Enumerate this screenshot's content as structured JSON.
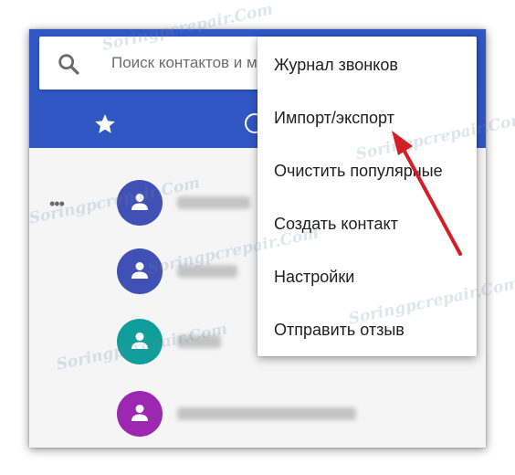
{
  "search": {
    "placeholder": "Поиск контактов и м"
  },
  "icons": {
    "search": "search-icon",
    "tab_favorites": "star-icon",
    "tab_frequent": "clock-icon",
    "overflow": "more-dots-icon",
    "avatar": "person-icon",
    "arrow": "red-arrow-icon"
  },
  "menu": {
    "items": [
      "Журнал звонков",
      "Импорт/экспорт",
      "Очистить популярные",
      "Создать контакт",
      "Настройки",
      "Отправить отзыв"
    ]
  },
  "contacts": [
    {
      "avatar_color": "#3f51b5"
    },
    {
      "avatar_color": "#3f51b5"
    },
    {
      "avatar_color": "#0f9e9a"
    },
    {
      "avatar_color": "#9c27b0"
    }
  ],
  "watermark": "Soringpcrepair.Com",
  "colors": {
    "appbar": "#3157c5",
    "arrow": "#d21f26",
    "menu_bg": "#ffffff"
  }
}
